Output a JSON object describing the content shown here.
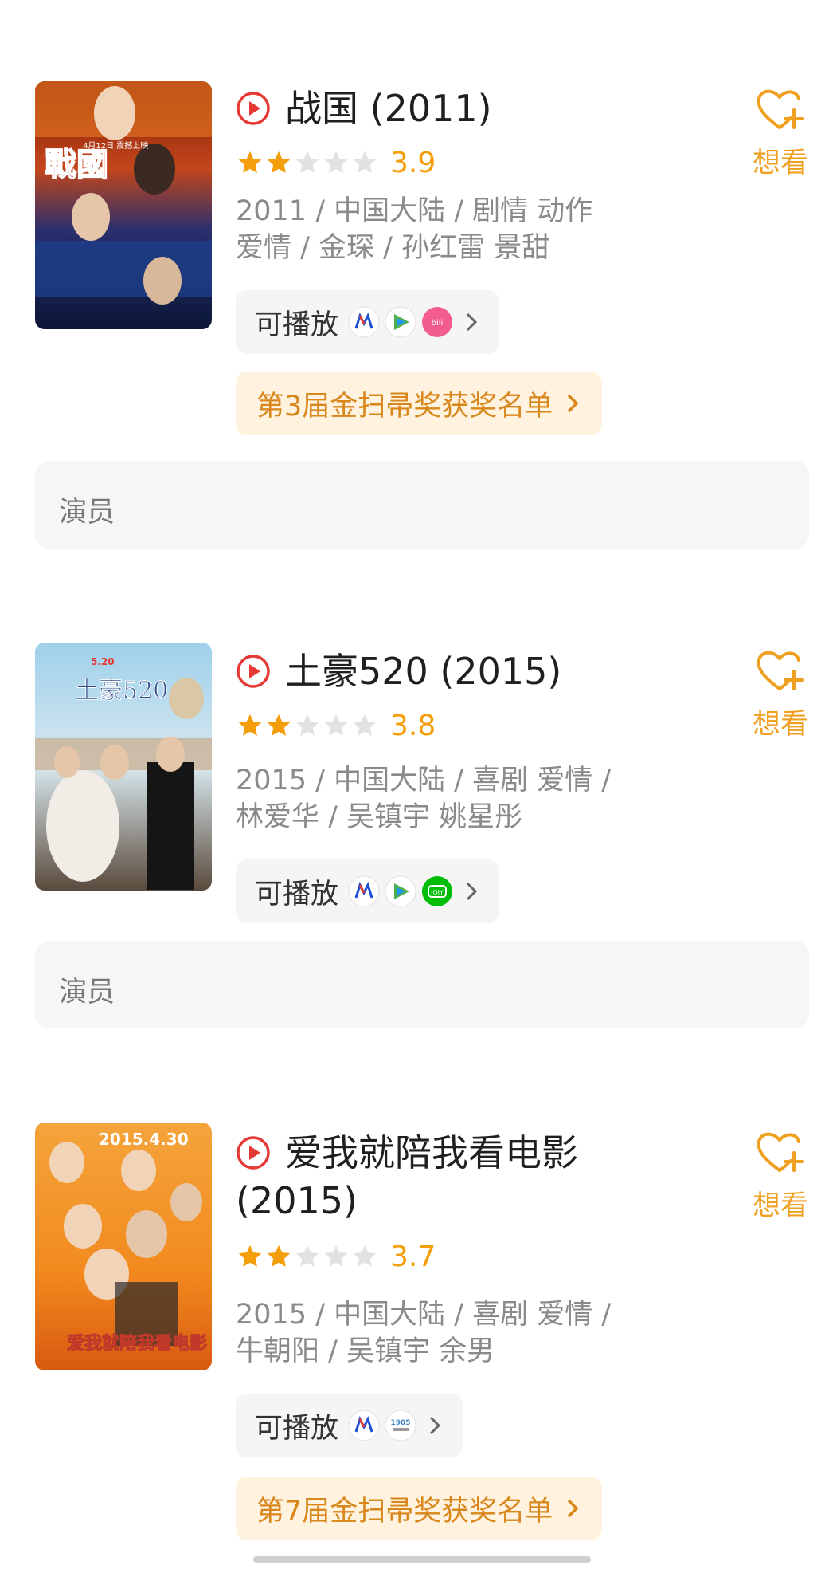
{
  "movies": [
    {
      "title": "战国 (2011)",
      "rating": 3.9,
      "rating_text": "3.9",
      "stars_filled": 2,
      "meta_line1": "2011 / 中国大陆 / 剧情 动作",
      "meta_line2": "爱情 / 金琛 / 孙红雷 景甜",
      "play_label": "可播放",
      "platforms": [
        "mgtv-icon",
        "tencent-video-icon",
        "bilibili-icon"
      ],
      "award": "第3届金扫帚奖获奖名单",
      "want_label": "想看",
      "cast_label": "演员",
      "poster_text": "戰國",
      "poster_date": "4月12日 震撼上映"
    },
    {
      "title": "土豪520 (2015)",
      "rating": 3.8,
      "rating_text": "3.8",
      "stars_filled": 2,
      "meta_line1": "2015 / 中国大陆 / 喜剧 爱情 /",
      "meta_line2": "林爱华 / 吴镇宇 姚星彤",
      "play_label": "可播放",
      "platforms": [
        "mgtv-icon",
        "tencent-video-icon",
        "iqiyi-icon"
      ],
      "want_label": "想看",
      "cast_label": "演员",
      "poster_text": "土豪520",
      "poster_date": "5.20"
    },
    {
      "title": "爱我就陪我看电影 (2015)",
      "rating": 3.7,
      "rating_text": "3.7",
      "stars_filled": 2,
      "meta_line1": "2015 / 中国大陆 / 喜剧 爱情 /",
      "meta_line2": "牛朝阳 / 吴镇宇 余男",
      "play_label": "可播放",
      "platforms": [
        "mgtv-icon",
        "m1905-icon"
      ],
      "award": "第7届金扫帚奖获奖名单",
      "want_label": "想看",
      "poster_text": "爱我就陪我看电影",
      "poster_date": "2015.4.30"
    }
  ],
  "colors": {
    "accent": "#f0a020",
    "star": "#f59e0b",
    "play_red": "#e53935",
    "award_bg": "#fff3e0"
  }
}
